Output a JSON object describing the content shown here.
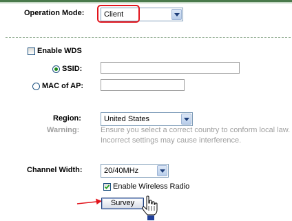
{
  "operation_mode": {
    "label": "Operation Mode:",
    "selected": "Client"
  },
  "wds": {
    "enable_label": "Enable WDS",
    "enabled": false,
    "ssid_label": "SSID:",
    "ssid_selected": true,
    "ssid_value": "",
    "mac_label": "MAC of AP:",
    "mac_selected": false,
    "mac_value": ""
  },
  "region": {
    "label": "Region:",
    "selected": "United States",
    "warning_label": "Warning:",
    "warning_line1": "Ensure you select a correct country to conform local law.",
    "warning_line2": "Incorrect settings may cause interference."
  },
  "channel_width": {
    "label": "Channel Width:",
    "selected": "20/40MHz"
  },
  "wireless_radio": {
    "label": "Enable Wireless Radio",
    "checked": true
  },
  "survey_button": {
    "label": "Survey"
  },
  "colors": {
    "highlight_red": "#e2141c",
    "accent_green": "#4a7a4c"
  }
}
